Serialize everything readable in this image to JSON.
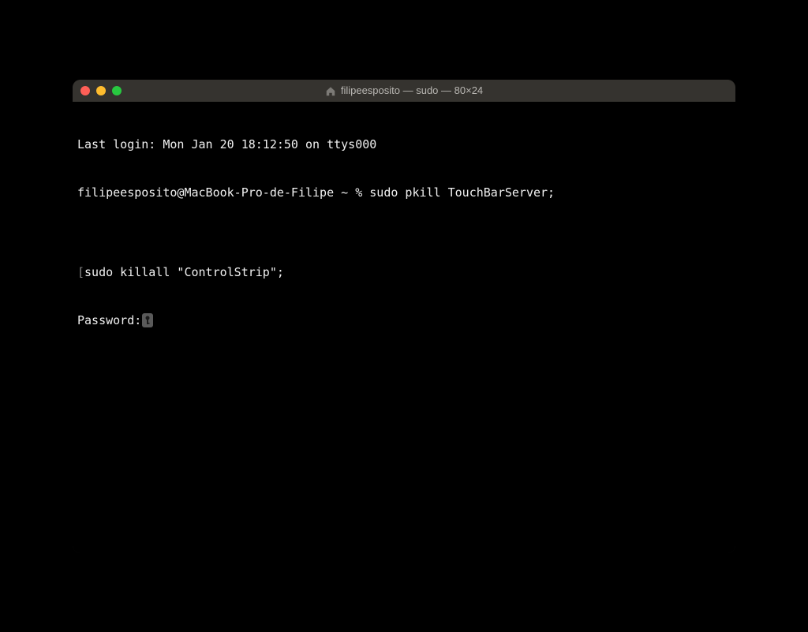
{
  "window": {
    "title": "filipeesposito — sudo — 80×24"
  },
  "terminal": {
    "line1": "Last login: Mon Jan 20 18:12:50 on ttys000",
    "prompt_user": "filipeesposito@MacBook-Pro-de-Filipe",
    "prompt_path": "~",
    "prompt_symbol": "%",
    "command1": "sudo pkill TouchBarServer;",
    "blank": "",
    "line3": "sudo killall \"ControlStrip\";",
    "password_label": "Password:"
  },
  "icons": {
    "home": "home-icon",
    "key": "key-icon"
  }
}
